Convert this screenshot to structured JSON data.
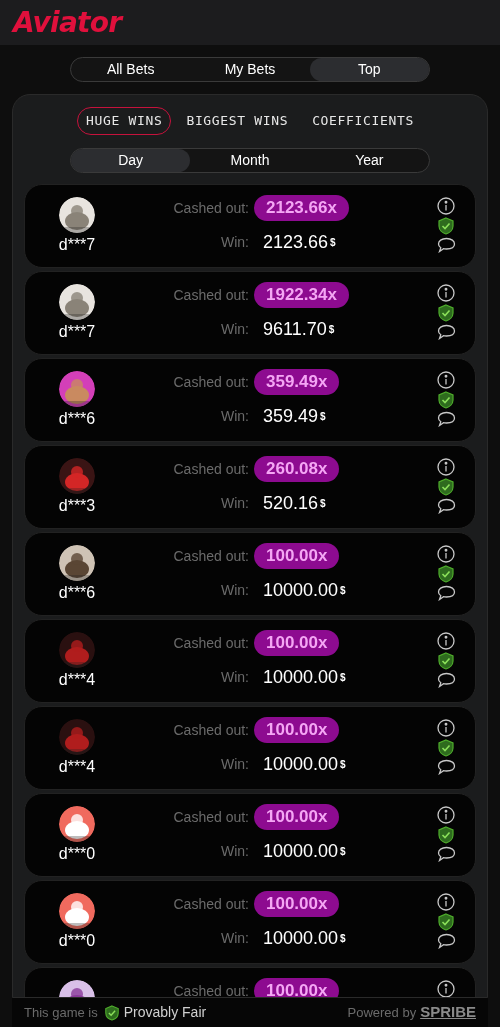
{
  "logo": "Aviator",
  "bet_tabs": [
    {
      "label": "All Bets",
      "selected": false
    },
    {
      "label": "My Bets",
      "selected": false
    },
    {
      "label": "Top",
      "selected": true
    }
  ],
  "category_tabs": [
    {
      "label": "HUGE WINS",
      "selected": true
    },
    {
      "label": "BIGGEST WINS",
      "selected": false
    },
    {
      "label": "COEFFICIENTS",
      "selected": false
    }
  ],
  "period_tabs": [
    {
      "label": "Day",
      "selected": true
    },
    {
      "label": "Month",
      "selected": false
    },
    {
      "label": "Year",
      "selected": false
    }
  ],
  "rows": [
    {
      "user": "d***7",
      "cashed_out_label": "Cashed out:",
      "multiplier": "2123.66x",
      "win_label": "Win:",
      "win": "2123.66",
      "currency": "$"
    },
    {
      "user": "d***7",
      "cashed_out_label": "Cashed out:",
      "multiplier": "1922.34x",
      "win_label": "Win:",
      "win": "9611.70",
      "currency": "$"
    },
    {
      "user": "d***6",
      "cashed_out_label": "Cashed out:",
      "multiplier": "359.49x",
      "win_label": "Win:",
      "win": "359.49",
      "currency": "$"
    },
    {
      "user": "d***3",
      "cashed_out_label": "Cashed out:",
      "multiplier": "260.08x",
      "win_label": "Win:",
      "win": "520.16",
      "currency": "$"
    },
    {
      "user": "d***6",
      "cashed_out_label": "Cashed out:",
      "multiplier": "100.00x",
      "win_label": "Win:",
      "win": "10000.00",
      "currency": "$"
    },
    {
      "user": "d***4",
      "cashed_out_label": "Cashed out:",
      "multiplier": "100.00x",
      "win_label": "Win:",
      "win": "10000.00",
      "currency": "$"
    },
    {
      "user": "d***4",
      "cashed_out_label": "Cashed out:",
      "multiplier": "100.00x",
      "win_label": "Win:",
      "win": "10000.00",
      "currency": "$"
    },
    {
      "user": "d***0",
      "cashed_out_label": "Cashed out:",
      "multiplier": "100.00x",
      "win_label": "Win:",
      "win": "10000.00",
      "currency": "$"
    },
    {
      "user": "d***0",
      "cashed_out_label": "Cashed out:",
      "multiplier": "100.00x",
      "win_label": "Win:",
      "win": "10000.00",
      "currency": "$"
    },
    {
      "cashed_out_label": "Cashed out:",
      "multiplier": "100.00x"
    }
  ],
  "footer": {
    "prefix": "This game is",
    "fair": "Provably Fair",
    "powered": "Powered by",
    "brand": "SPRIBE"
  }
}
